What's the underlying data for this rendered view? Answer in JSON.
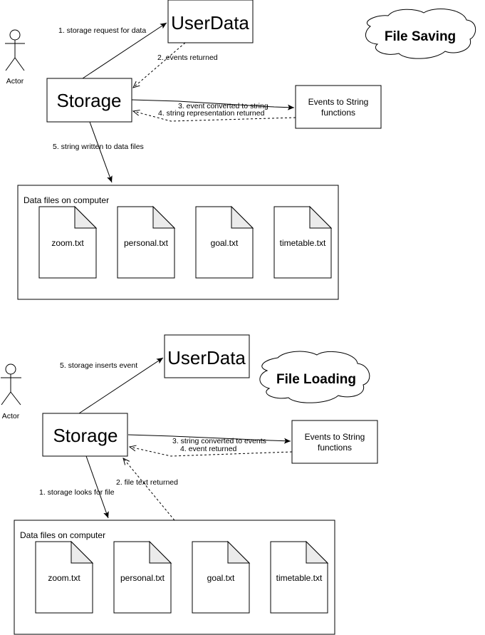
{
  "diagrams": [
    {
      "id": "saving",
      "title": "File Saving",
      "actor_label": "Actor",
      "storage_label": "Storage",
      "userdata_label": "UserData",
      "converter_label_line1": "Events to String",
      "converter_label_line2": "functions",
      "container_label": "Data files on computer",
      "files": [
        "zoom.txt",
        "personal.txt",
        "goal.txt",
        "timetable.txt"
      ],
      "messages": {
        "m1": "1. storage request for data",
        "m2": "2. events returned",
        "m3": "3. event converted to string",
        "m4": "4. string representation returned",
        "m5": "5. string written to data files"
      }
    },
    {
      "id": "loading",
      "title": "File Loading",
      "actor_label": "Actor",
      "storage_label": "Storage",
      "userdata_label": "UserData",
      "converter_label_line1": "Events to String",
      "converter_label_line2": "functions",
      "container_label": "Data files on computer",
      "files": [
        "zoom.txt",
        "personal.txt",
        "goal.txt",
        "timetable.txt"
      ],
      "messages": {
        "m1": "1. storage looks for file",
        "m2": "2. file text returned",
        "m3": "3. string converted to events",
        "m4": "4. event returned",
        "m5": "5. storage inserts event"
      }
    }
  ],
  "colors": {
    "stroke": "#000000",
    "background": "#ffffff",
    "fold": "#ebebeb"
  }
}
